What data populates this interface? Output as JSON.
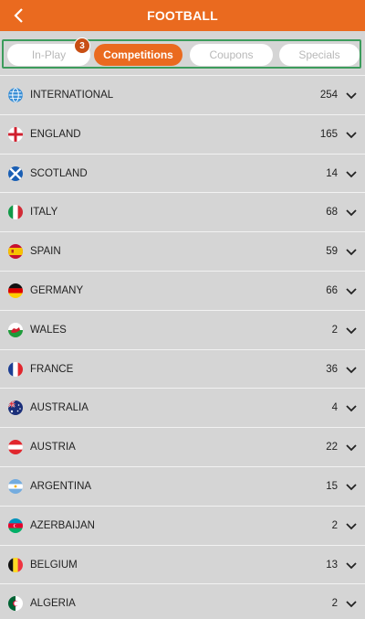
{
  "header": {
    "title": "FOOTBALL"
  },
  "tabs": [
    {
      "label": "In-Play"
    },
    {
      "label": "Competitions"
    },
    {
      "label": "Coupons"
    },
    {
      "label": "Specials"
    }
  ],
  "inplay_badge": "3",
  "competitions": [
    {
      "name": "INTERNATIONAL",
      "count": "254",
      "flag": "globe-icon"
    },
    {
      "name": "ENGLAND",
      "count": "165",
      "flag": "england-flag-icon"
    },
    {
      "name": "SCOTLAND",
      "count": "14",
      "flag": "scotland-flag-icon"
    },
    {
      "name": "ITALY",
      "count": "68",
      "flag": "italy-flag-icon"
    },
    {
      "name": "SPAIN",
      "count": "59",
      "flag": "spain-flag-icon"
    },
    {
      "name": "GERMANY",
      "count": "66",
      "flag": "germany-flag-icon"
    },
    {
      "name": "WALES",
      "count": "2",
      "flag": "wales-flag-icon"
    },
    {
      "name": "FRANCE",
      "count": "36",
      "flag": "france-flag-icon"
    },
    {
      "name": "AUSTRALIA",
      "count": "4",
      "flag": "australia-flag-icon"
    },
    {
      "name": "AUSTRIA",
      "count": "22",
      "flag": "austria-flag-icon"
    },
    {
      "name": "ARGENTINA",
      "count": "15",
      "flag": "argentina-flag-icon"
    },
    {
      "name": "AZERBAIJAN",
      "count": "2",
      "flag": "azerbaijan-flag-icon"
    },
    {
      "name": "BELGIUM",
      "count": "13",
      "flag": "belgium-flag-icon"
    },
    {
      "name": "ALGERIA",
      "count": "2",
      "flag": "algeria-flag-icon"
    }
  ],
  "colors": {
    "brand": "#ea6a1f",
    "tab_outline": "#3c9c5c",
    "background": "#d5d5d5"
  }
}
